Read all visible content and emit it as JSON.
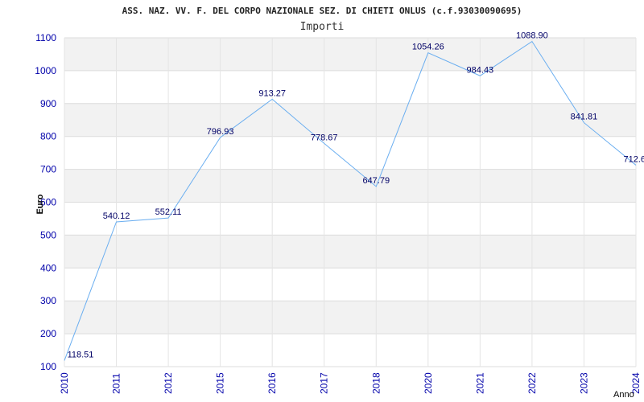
{
  "chart_data": {
    "type": "line",
    "title": "ASS. NAZ. VV. F. DEL CORPO NAZIONALE SEZ. DI CHIETI ONLUS (c.f.93030090695)",
    "subtitle": "Importi",
    "xlabel": "Anno",
    "ylabel": "Euro",
    "categories": [
      "2010",
      "2011",
      "2012",
      "2015",
      "2016",
      "2017",
      "2018",
      "2020",
      "2021",
      "2022",
      "2023",
      "2024"
    ],
    "values": [
      118.51,
      540.12,
      552.11,
      796.93,
      913.27,
      778.67,
      647.79,
      1054.26,
      984.43,
      1088.9,
      841.81,
      712.6
    ],
    "value_labels": [
      "118.51",
      "540.12",
      "552.11",
      "796.93",
      "913.27",
      "778.67",
      "647.79",
      "1054.26",
      "984.43",
      "1088.90",
      "841.81",
      "712.6"
    ],
    "ylim": [
      100,
      1100
    ],
    "yticks": [
      "100",
      "200",
      "300",
      "400",
      "500",
      "600",
      "700",
      "800",
      "900",
      "1000",
      "1100"
    ],
    "grid": true,
    "colors": {
      "line": "#6aaef0",
      "band": "#f2f2f2",
      "tick_text": "#0000aa"
    }
  }
}
